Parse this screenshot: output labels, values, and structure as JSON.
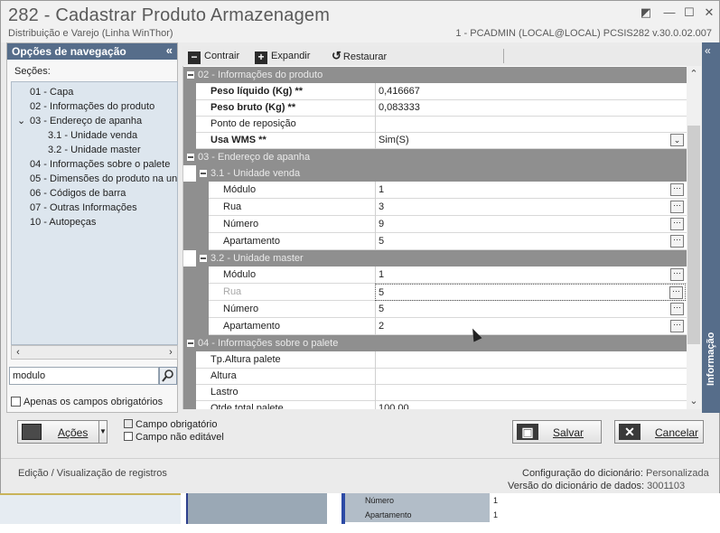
{
  "window": {
    "title": "282 - Cadastrar Produto Armazenagem",
    "subtitle": "Distribuição e Varejo (Linha WinThor)",
    "session": "1 - PCADMIN (LOCAL@LOCAL)   PCSIS282  v.30.0.02.007"
  },
  "nav": {
    "header": "Opções de navegação",
    "sections_label": "Seções:",
    "items": [
      {
        "label": "01 - Capa"
      },
      {
        "label": "02 - Informações do produto"
      },
      {
        "label": "03 - Endereço de apanha"
      },
      {
        "label": "3.1 - Unidade venda"
      },
      {
        "label": "3.2 - Unidade master"
      },
      {
        "label": "04 - Informações sobre o palete"
      },
      {
        "label": "05 - Dimensões do produto na unid"
      },
      {
        "label": "06 - Códigos de barra"
      },
      {
        "label": "07 - Outras Informações"
      },
      {
        "label": "10 - Autopeças"
      }
    ],
    "search_value": "modulo",
    "required_only_label": "Apenas os campos obrigatórios"
  },
  "toolbar": {
    "collapse_label": "Contrair",
    "expand_label": "Expandir",
    "restore_label": "Restaurar"
  },
  "grid": {
    "cat02": "02 - Informações do produto",
    "peso_liquido": {
      "label": "Peso líquido (Kg) **",
      "value": "0,416667"
    },
    "peso_bruto": {
      "label": "Peso bruto (Kg) **",
      "value": "0,083333"
    },
    "ponto_reposicao": {
      "label": "Ponto de reposição",
      "value": ""
    },
    "usa_wms": {
      "label": "Usa WMS **",
      "value": "Sim(S)"
    },
    "cat03": "03 - Endereço de apanha",
    "sub31": "3.1 - Unidade venda",
    "venda": {
      "modulo": {
        "label": "Módulo",
        "value": "1"
      },
      "rua": {
        "label": "Rua",
        "value": "3"
      },
      "numero": {
        "label": "Número",
        "value": "9"
      },
      "apartamento": {
        "label": "Apartamento",
        "value": "5"
      }
    },
    "sub32": "3.2 - Unidade master",
    "master": {
      "modulo": {
        "label": "Módulo",
        "value": "1"
      },
      "rua": {
        "label": "Rua",
        "value": "5"
      },
      "numero": {
        "label": "Número",
        "value": "5"
      },
      "apartamento": {
        "label": "Apartamento",
        "value": "2"
      }
    },
    "cat04": "04 - Informações sobre o palete",
    "tp_altura": {
      "label": "Tp.Altura palete",
      "value": ""
    },
    "altura": {
      "label": "Altura",
      "value": ""
    },
    "lastro": {
      "label": "Lastro",
      "value": ""
    },
    "qtde_total": {
      "label": "Qtde total palete",
      "value": "100,00"
    },
    "ellipsis": "···"
  },
  "info_panel": {
    "label": "Informação"
  },
  "actions": {
    "label": "Ações"
  },
  "legend": {
    "required": "Campo obrigatório",
    "not_editable": "Campo não editável"
  },
  "buttons": {
    "save": "Salvar",
    "cancel": "Cancelar"
  },
  "status": {
    "mode": "Edição / Visualização de registros",
    "dict_config_label": "Configuração do dicionário:",
    "dict_config_value": "Personalizada",
    "dict_version_label": "Versão do dicionário de dados:",
    "dict_version_value": "3001103"
  },
  "background": {
    "rows": [
      {
        "key": "Número",
        "value": "1"
      },
      {
        "key": "Apartamento",
        "value": "1"
      }
    ]
  }
}
